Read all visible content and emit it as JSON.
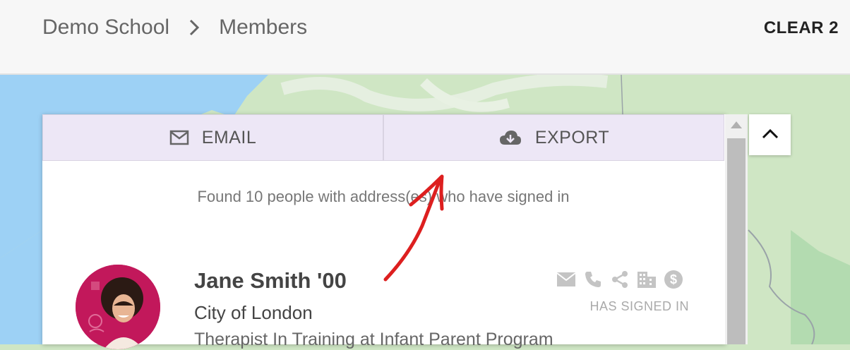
{
  "breadcrumb": {
    "root": "Demo School",
    "current": "Members",
    "separator_icon": "chevron-right-icon"
  },
  "header": {
    "clear_label": "CLEAR 2"
  },
  "actions": {
    "email": {
      "label": "EMAIL",
      "icon": "mail-outline-icon"
    },
    "export": {
      "label": "EXPORT",
      "icon": "cloud-download-icon"
    }
  },
  "results": {
    "found_text": "Found 10 people with address(es) who have signed in"
  },
  "member": {
    "name": "Jane Smith '00",
    "location": "City of London",
    "title": "Therapist In Training at Infant Parent Program",
    "status": "HAS SIGNED IN",
    "contact_icons": [
      "email-icon",
      "phone-icon",
      "share-icon",
      "building-icon",
      "dollar-icon"
    ]
  },
  "colors": {
    "action_bg": "#ede7f6",
    "annotation": "#dd1f1f",
    "avatar_bg": "#c2185b",
    "map_green": "#cfe6c4",
    "water": "#9dd1f5"
  }
}
